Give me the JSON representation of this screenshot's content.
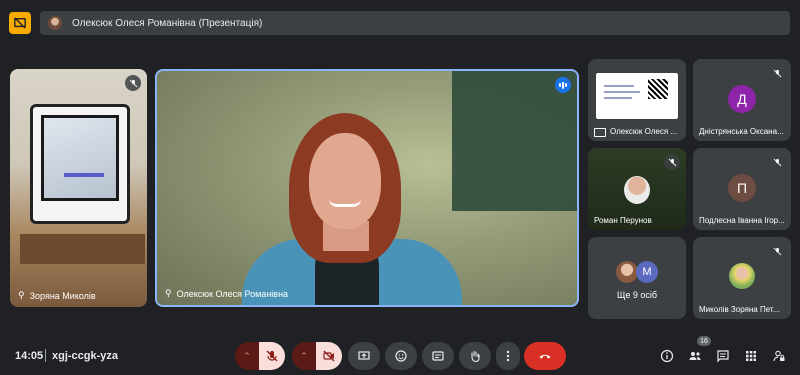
{
  "header": {
    "presentation_title": "Олексюк Олеся Романівна (Презентація)"
  },
  "tiles": {
    "left": {
      "name": "Зоряна Миколів"
    },
    "main": {
      "name": "Олексюк Олеся Романівна"
    },
    "grid": [
      {
        "name": "Олексюк Олеся ..."
      },
      {
        "name": "Дністрянська Оксана...",
        "initial": "Д"
      },
      {
        "name": "Роман Перунов"
      },
      {
        "name": "Подлесна Іванна Ігор...",
        "initial": "П"
      },
      {
        "more_label": "Ще 9 осіб",
        "initial": "M"
      },
      {
        "name": "Миколів Зоряна Пет..."
      }
    ]
  },
  "bottombar": {
    "time": "14:05",
    "meeting_code": "xgj-ccgk-yza",
    "participants_count": "16"
  },
  "colors": {
    "accent": "#8ab4f8",
    "end_call": "#d93025",
    "muted_bg": "#f9dedc",
    "app_logo": "#f9ab00"
  }
}
